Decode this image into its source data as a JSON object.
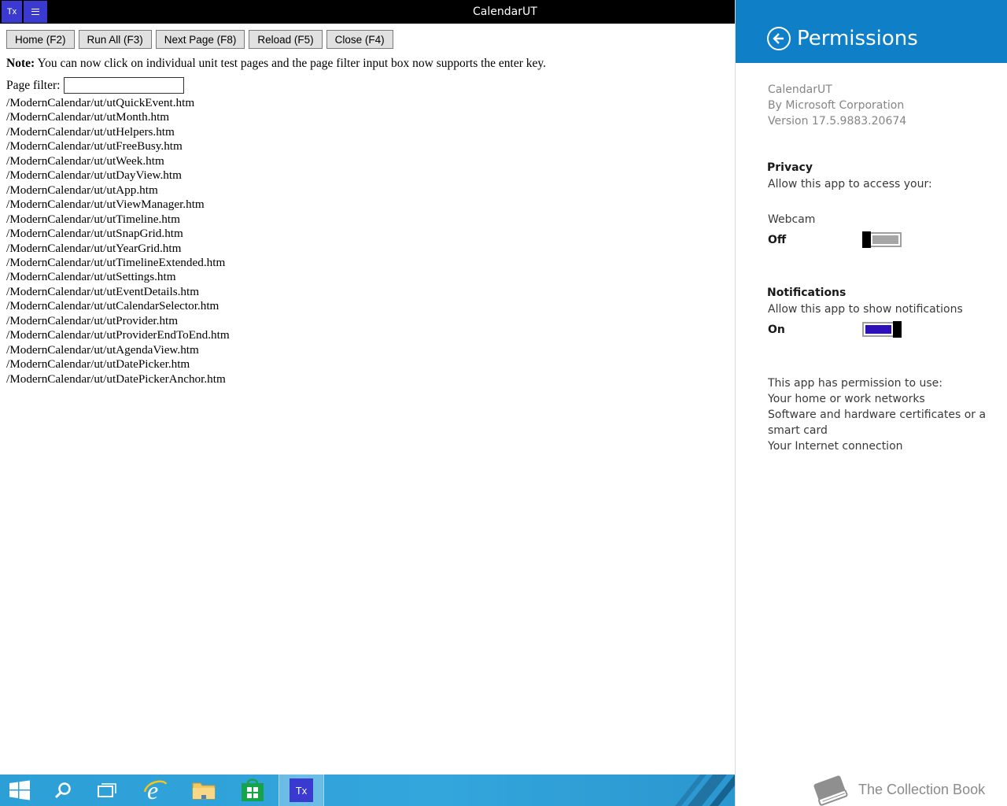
{
  "window": {
    "title": "CalendarUT",
    "app_icon_text": "Tx",
    "menu_icon": "hamburger-icon"
  },
  "toolbar": {
    "buttons": [
      "Home (F2)",
      "Run All (F3)",
      "Next Page (F8)",
      "Reload (F5)",
      "Close (F4)"
    ]
  },
  "note": {
    "label": "Note:",
    "text": " You can now click on individual unit test pages and the page filter input box now supports the enter key."
  },
  "filter": {
    "label": "Page filter:",
    "value": ""
  },
  "pages": [
    "/ModernCalendar/ut/utQuickEvent.htm",
    "/ModernCalendar/ut/utMonth.htm",
    "/ModernCalendar/ut/utHelpers.htm",
    "/ModernCalendar/ut/utFreeBusy.htm",
    "/ModernCalendar/ut/utWeek.htm",
    "/ModernCalendar/ut/utDayView.htm",
    "/ModernCalendar/ut/utApp.htm",
    "/ModernCalendar/ut/utViewManager.htm",
    "/ModernCalendar/ut/utTimeline.htm",
    "/ModernCalendar/ut/utSnapGrid.htm",
    "/ModernCalendar/ut/utYearGrid.htm",
    "/ModernCalendar/ut/utTimelineExtended.htm",
    "/ModernCalendar/ut/utSettings.htm",
    "/ModernCalendar/ut/utEventDetails.htm",
    "/ModernCalendar/ut/utCalendarSelector.htm",
    "/ModernCalendar/ut/utProvider.htm",
    "/ModernCalendar/ut/utProviderEndToEnd.htm",
    "/ModernCalendar/ut/utAgendaView.htm",
    "/ModernCalendar/ut/utDatePicker.htm",
    "/ModernCalendar/ut/utDatePickerAnchor.htm"
  ],
  "permissions": {
    "title": "Permissions",
    "accent_color": "#0f7fc7",
    "app_name": "CalendarUT",
    "publisher": "By Microsoft Corporation",
    "version": "Version 17.5.9883.20674",
    "privacy_heading": "Privacy",
    "privacy_desc": "Allow this app to access your:",
    "webcam_label": "Webcam",
    "webcam_state": "Off",
    "webcam_on": false,
    "notifications_heading": "Notifications",
    "notifications_desc": "Allow this app to show notifications",
    "notifications_state": "On",
    "notifications_on": true,
    "capabilities_heading": "This app has permission to use:",
    "capabilities": [
      "Your home or work networks",
      "Software and hardware certificates or a",
      "smart card",
      "Your Internet connection"
    ]
  },
  "watermark": "The Collection Book",
  "taskbar": {
    "items": [
      "start-icon",
      "search-icon",
      "task-view-icon",
      "internet-explorer-icon",
      "file-explorer-icon",
      "store-icon",
      "calendarut-app-icon"
    ],
    "active_app_text": "Tx"
  }
}
